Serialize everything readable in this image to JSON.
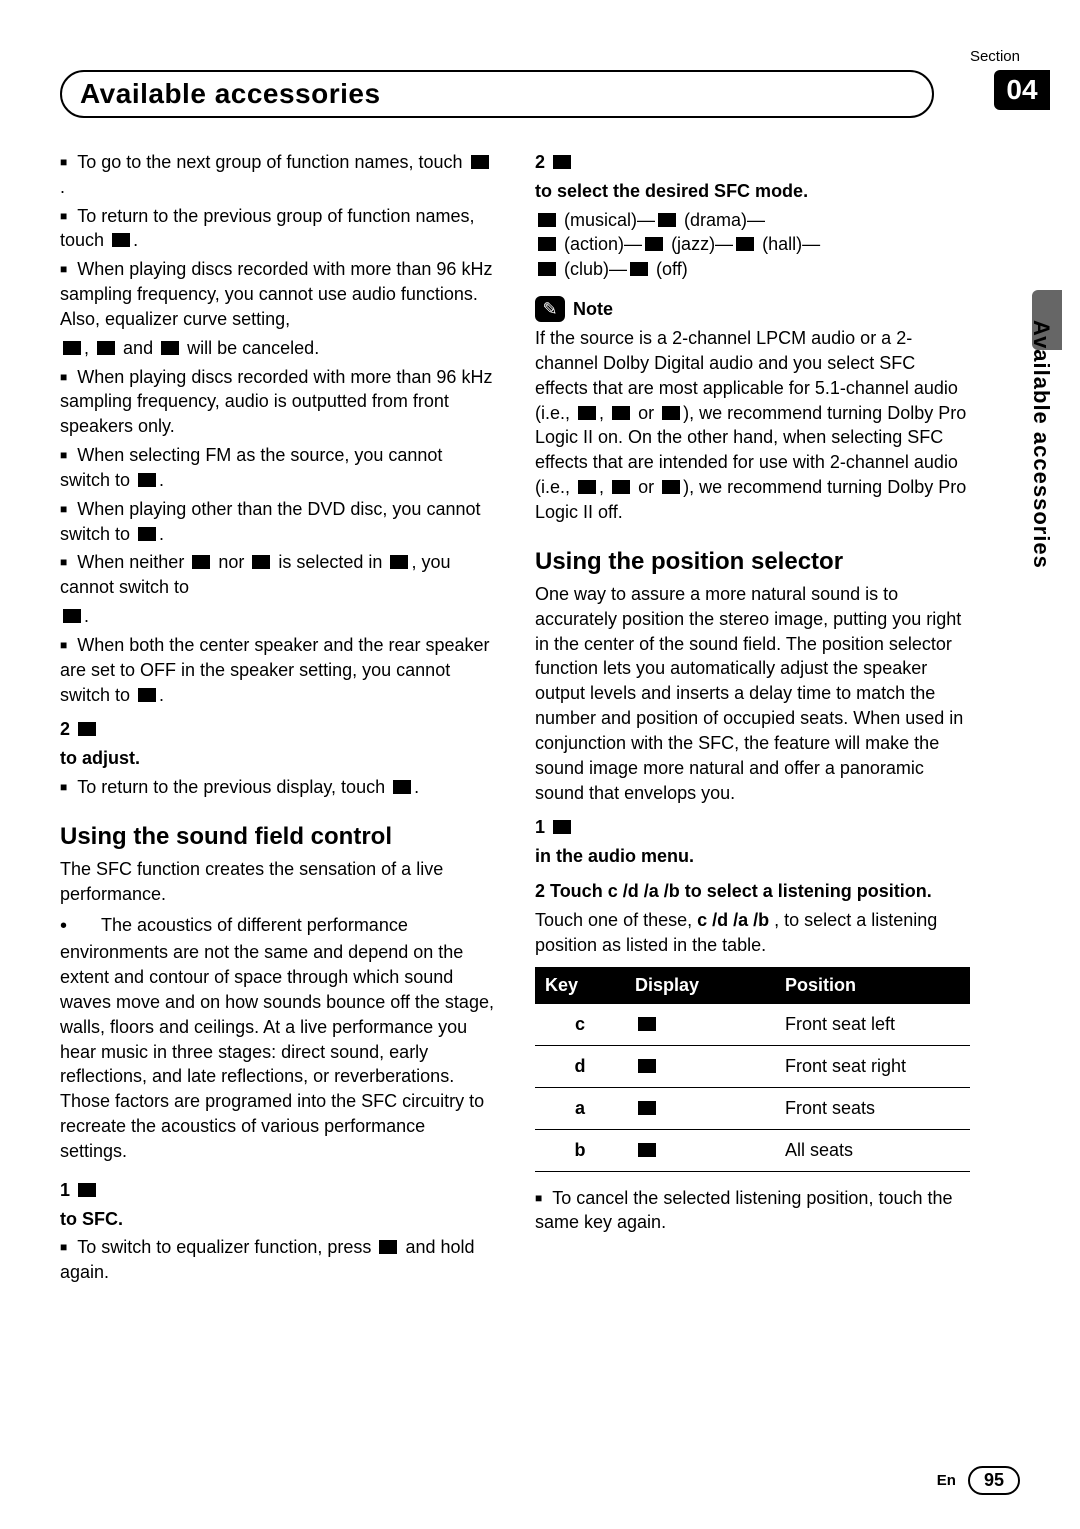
{
  "header": {
    "section_label": "Section",
    "section_number": "04",
    "title": "Available accessories",
    "side_text": "Available accessories"
  },
  "left": {
    "b1": "To go to the next group of function names, touch",
    "b1b": ".",
    "b2a": "To return to the previous group of function names, touch",
    "b2b": ".",
    "b3": "When playing discs recorded with more than 96 kHz sampling frequency, you cannot use audio functions. Also, equalizer curve setting,",
    "b3mid": ",",
    "b3and": "and",
    "b3end": "will be canceled.",
    "b4": "When playing discs recorded with more than 96 kHz sampling frequency, audio is outputted from front speakers only.",
    "b5a": "When selecting FM as the source, you cannot switch to",
    "b5b": ".",
    "b6a": "When playing other than the DVD disc, you cannot switch to",
    "b6b": ".",
    "b7a": "When neither",
    "b7b": "nor",
    "b7c": "is selected in",
    "b7d": ", you cannot switch to",
    "b7e": ".",
    "b8a": "When both the center speaker and the rear speaker are set to OFF in the speaker setting, you cannot switch to",
    "b8b": ".",
    "step2a": "2",
    "step2b": " ",
    "step2line2": "to adjust.",
    "ret_a": "To return to the previous display, touch",
    "ret_b": ".",
    "sfc_title": "Using the sound field control",
    "sfc_intro": "The SFC function creates the sensation of a live performance.",
    "sfc_bullet": "The acoustics of different performance environments are not the same and depend on the extent and contour of space through which sound waves move and on how sounds bounce off the stage, walls, floors and ceilings. At a live performance you hear music in three stages: direct sound, early reflections, and late reflections, or reverberations. Those factors are programed into the SFC circuitry to recreate the acoustics of various performance settings.",
    "sfc_step1_num": "1",
    "sfc_step1_a": " ",
    "sfc_step1_b": "to SFC.",
    "sfc_eq_a": "To switch to equalizer function, press",
    "sfc_eq_b": "and hold again."
  },
  "right": {
    "r_step2_num": "2",
    "r_step2_a": " ",
    "r_step2_b": "to select the desired SFC mode.",
    "modes": {
      "m1a": "(musical)—",
      "m1b": "(drama)—",
      "m2a": "(action)—",
      "m2b": "(jazz)—",
      "m2c": "(hall)—",
      "m3a": "(club)—",
      "m3b": "(off)"
    },
    "note_label": "Note",
    "note_text_1": "If the source is a 2-channel LPCM audio or a 2-channel Dolby Digital audio and you select SFC effects that are most applicable for 5.1-channel audio (i.e.,",
    "note_text_2": ",",
    "note_text_3": "or",
    "note_text_4": "), we recommend turning Dolby Pro Logic II on. On the other hand, when selecting SFC effects that are intended for use with 2-channel audio (i.e.,",
    "note_text_5": ",",
    "note_text_6": "or",
    "note_text_7": "), we recommend turning Dolby Pro Logic II off.",
    "pos_title": "Using the position selector",
    "pos_intro": "One way to assure a more natural sound is to accurately position the stereo image, putting you right in the center of the sound field. The position selector function lets you automatically adjust the speaker output levels and inserts a delay time to match the number and position of occupied seats. When used in conjunction with the SFC, the feature will make the sound image more natural and offer a panoramic sound that envelops you.",
    "pos_step1_num": "1",
    "pos_step1_a": " ",
    "pos_step1_b": "in the audio menu.",
    "pos_step2_num": "2",
    "pos_step2_a": "Touch",
    "pos_step2_keys": "c /d /a /b",
    "pos_step2_b": "to select a listening position.",
    "pos_desc": "Touch one of these, ",
    "pos_keys_inline": "c /d /a /b",
    "pos_desc2": " , to select a listening position as listed in the table.",
    "table": {
      "h1": "Key",
      "h2": "Display",
      "h3": "Position",
      "rows": [
        {
          "k": "c",
          "p": "Front seat left"
        },
        {
          "k": "d",
          "p": "Front seat right"
        },
        {
          "k": "a",
          "p": "Front seats"
        },
        {
          "k": "b",
          "p": "All seats"
        }
      ]
    },
    "cancel": "To cancel the selected listening position, touch the same key again."
  },
  "footer": {
    "lang": "En",
    "page": "95"
  }
}
